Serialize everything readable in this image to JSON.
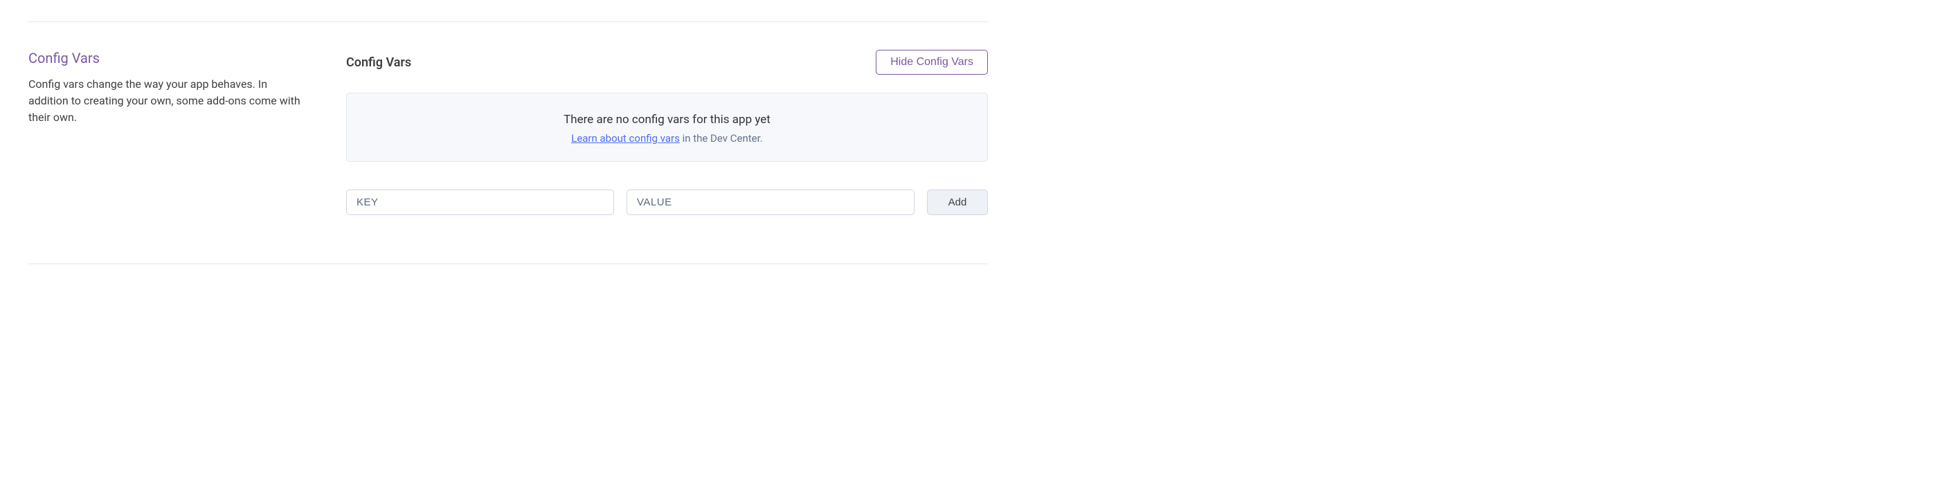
{
  "sidebar": {
    "title": "Config Vars",
    "description": "Config vars change the way your app behaves. In addition to creating your own, some add-ons come with their own."
  },
  "panel": {
    "title": "Config Vars",
    "hide_button_label": "Hide Config Vars",
    "empty_state": {
      "message": "There are no config vars for this app yet",
      "link_text": "Learn about config vars",
      "suffix_text": " in the Dev Center."
    },
    "form": {
      "key_placeholder": "KEY",
      "value_placeholder": "VALUE",
      "add_button_label": "Add"
    }
  }
}
